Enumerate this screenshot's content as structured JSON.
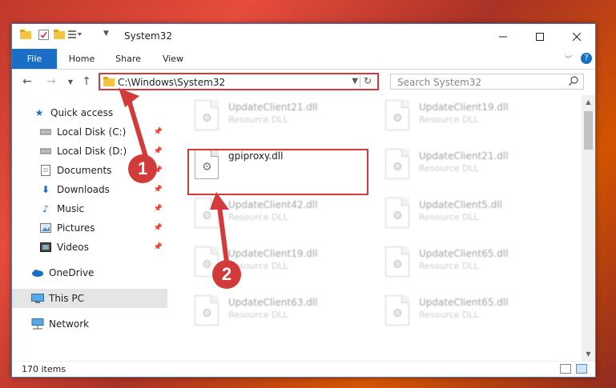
{
  "window": {
    "title": "System32",
    "minimize_icon": "minimize-icon",
    "maximize_icon": "maximize-icon",
    "close_icon": "close-icon"
  },
  "ribbon": {
    "tabs": [
      "File",
      "Home",
      "Share",
      "View"
    ],
    "accent": "#1a6ec5"
  },
  "address": {
    "path": "C:\\Windows\\System32"
  },
  "search": {
    "placeholder": "Search System32"
  },
  "sidebar": {
    "items": [
      {
        "label": "Quick access",
        "icon": "star-icon",
        "pinned": false
      },
      {
        "label": "Local Disk (C:)",
        "icon": "drive-icon",
        "pinned": true
      },
      {
        "label": "Local Disk (D:)",
        "icon": "drive-icon",
        "pinned": true
      },
      {
        "label": "Documents",
        "icon": "documents-icon",
        "pinned": true
      },
      {
        "label": "Downloads",
        "icon": "download-icon",
        "pinned": true
      },
      {
        "label": "Music",
        "icon": "music-icon",
        "pinned": true
      },
      {
        "label": "Pictures",
        "icon": "pictures-icon",
        "pinned": true
      },
      {
        "label": "Videos",
        "icon": "videos-icon",
        "pinned": true
      },
      {
        "label": "OneDrive",
        "icon": "cloud-icon",
        "pinned": false
      },
      {
        "label": "This PC",
        "icon": "computer-icon",
        "pinned": false
      },
      {
        "label": "Network",
        "icon": "network-icon",
        "pinned": false
      }
    ]
  },
  "files": [
    {
      "name": "UpdateClient21.dll",
      "type": "Resource DLL"
    },
    {
      "name": "UpdateClient19.dll",
      "type": "Resource DLL"
    },
    {
      "name": "gpiproxy.dll",
      "type": ""
    },
    {
      "name": "UpdateClient21.dll",
      "type": "Resource DLL"
    },
    {
      "name": "UpdateClient42.dll",
      "type": "Resource DLL"
    },
    {
      "name": "UpdateClient5.dll",
      "type": "Resource DLL"
    },
    {
      "name": "UpdateClient19.dll",
      "type": "Resource DLL"
    },
    {
      "name": "UpdateClient65.dll",
      "type": "Resource DLL"
    },
    {
      "name": "UpdateClient63.dll",
      "type": "Resource DLL"
    },
    {
      "name": "UpdateClient65.dll",
      "type": "Resource DLL"
    }
  ],
  "status": {
    "item_count": "170 items"
  },
  "annotations": {
    "callout1": "1",
    "callout2": "2",
    "color": "#d33a3a"
  }
}
